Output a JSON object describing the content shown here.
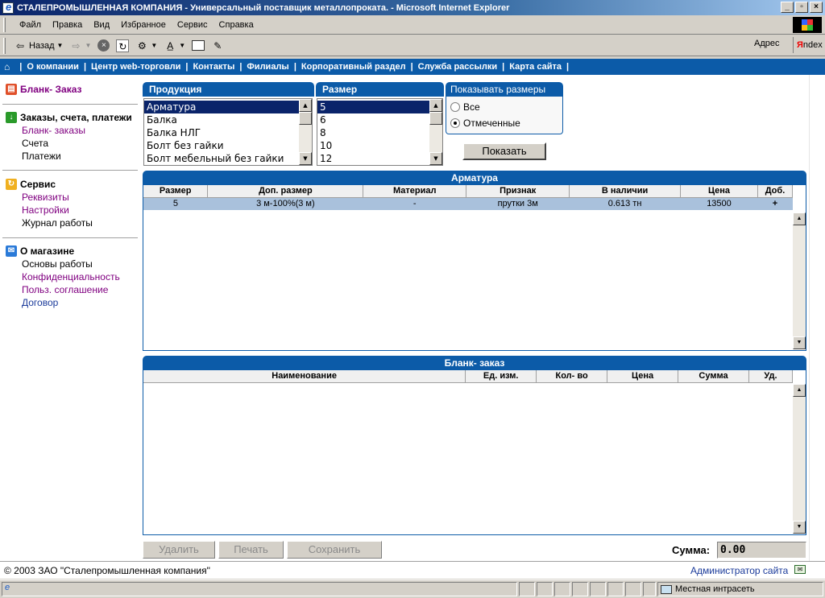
{
  "window": {
    "title": "СТАЛЕПРОМЫШЛЕННАЯ КОМПАНИЯ - Универсальный поставщик металлопроката. - Microsoft Internet Explorer"
  },
  "menu": [
    "Файл",
    "Правка",
    "Вид",
    "Избранное",
    "Сервис",
    "Справка"
  ],
  "toolbar": {
    "back_label": "Назад",
    "address_label": "Адрес",
    "yandex_label": "ndex",
    "yandex_letter": "Я"
  },
  "nav": {
    "items": [
      "О компании",
      "Центр web-торговли",
      "Контакты",
      "Филиалы",
      "Корпоративный раздел",
      "Служба рассылки",
      "Карта сайта"
    ]
  },
  "sidebar": {
    "blank_order": "Бланк- Заказ",
    "orders_header": "Заказы, счета, платежи",
    "orders_items": [
      "Бланк- заказы",
      "Счета",
      "Платежи"
    ],
    "service_header": "Сервис",
    "service_items": [
      "Реквизиты",
      "Настройки",
      "Журнал работы"
    ],
    "shop_header": "О магазине",
    "shop_items": [
      "Основы работы",
      "Конфиденциальность",
      "Польз. соглашение",
      "Договор"
    ]
  },
  "products": {
    "header": "Продукция",
    "items": [
      "Арматура",
      "Балка",
      "Балка НЛГ",
      "Болт без гайки",
      "Болт мебельный без гайки"
    ],
    "selected_index": 0
  },
  "sizes": {
    "header": "Размер",
    "items": [
      "5",
      "6",
      "8",
      "10",
      "12"
    ],
    "selected_index": 0
  },
  "show_sizes": {
    "header": "Показывать размеры",
    "option_all": "Все",
    "option_marked": "Отмеченные",
    "selected": "Отмеченные"
  },
  "show_button": "Показать",
  "results": {
    "title": "Арматура",
    "columns": [
      "Размер",
      "Доп. размер",
      "Материал",
      "Признак",
      "В наличии",
      "Цена",
      "Доб."
    ],
    "rows": [
      [
        "5",
        "3 м-100%(3 м)",
        "-",
        "прутки 3м",
        "0.613 тн",
        "13500",
        "+"
      ]
    ]
  },
  "order": {
    "title": "Бланк- заказ",
    "columns": [
      "Наименование",
      "Ед. изм.",
      "Кол- во",
      "Цена",
      "Сумма",
      "Уд."
    ]
  },
  "actions": {
    "delete": "Удалить",
    "print": "Печать",
    "save": "Сохранить",
    "sum_label": "Сумма:",
    "sum_value": "0.00"
  },
  "footer": {
    "copyright": "© 2003 ЗАО \"Сталепромышленная компания\"",
    "admin_link": "Администратор сайта"
  },
  "status": {
    "zone": "Местная интрасеть"
  }
}
